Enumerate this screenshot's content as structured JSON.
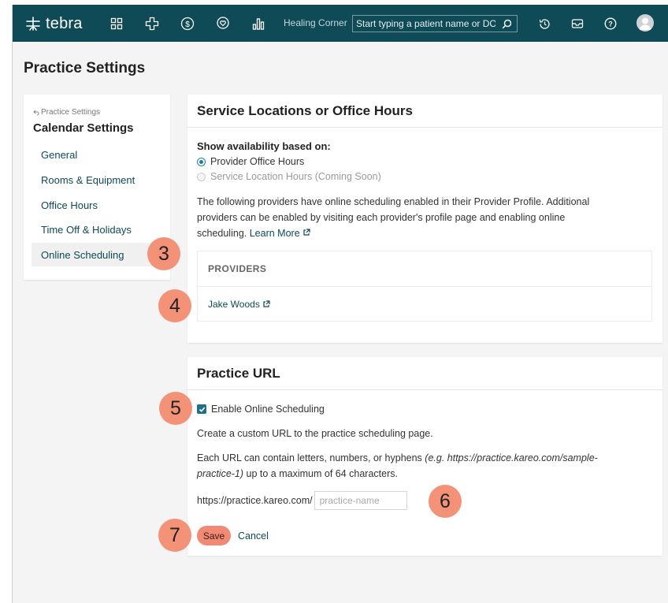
{
  "header": {
    "brand": "tebra",
    "practice_name": "Healing Corner",
    "search_placeholder": "Start typing a patient name or DOB"
  },
  "page": {
    "title": "Practice Settings"
  },
  "sidebar": {
    "back_label": "Practice Settings",
    "title": "Calendar Settings",
    "items": [
      {
        "label": "General"
      },
      {
        "label": "Rooms & Equipment"
      },
      {
        "label": "Office Hours"
      },
      {
        "label": "Time Off & Holidays"
      },
      {
        "label": "Online Scheduling",
        "active": true
      }
    ]
  },
  "service_locations": {
    "title": "Service Locations or Office Hours",
    "availability_label": "Show availability based on:",
    "options": [
      {
        "label": "Provider Office Hours",
        "selected": true
      },
      {
        "label": "Service Location Hours (Coming Soon)",
        "selected": false
      }
    ],
    "description_line1": "The following providers have online scheduling enabled in their Provider Profile. Additional",
    "description_line2": "providers can be enabled by visiting each provider's profile page and enabling online",
    "description_line3": "scheduling.",
    "learn_more": "Learn More",
    "providers_header": "PROVIDERS",
    "providers": [
      {
        "name": "Jake Woods"
      }
    ]
  },
  "practice_url": {
    "title": "Practice URL",
    "enable_label": "Enable Online Scheduling",
    "enabled": true,
    "intro": "Create a custom URL to the practice scheduling page.",
    "rules_prefix": "Each URL can contain letters, numbers, or hyphens ",
    "rules_example_1": "(e.g. https://practice.kareo.com/sample-",
    "rules_example_2": "practice-1)",
    "rules_suffix": " up to a maximum of 64 characters.",
    "url_prefix": "https://practice.kareo.com/",
    "url_placeholder": "practice-name",
    "url_value": "",
    "save_label": "Save",
    "cancel_label": "Cancel"
  },
  "callouts": [
    "3",
    "4",
    "5",
    "6",
    "7"
  ],
  "colors": {
    "topbar": "#0f4a57",
    "link": "#0f4a57",
    "accent": "#1d7ea1",
    "save_button": "#f08a74",
    "callout": "#f39276"
  }
}
